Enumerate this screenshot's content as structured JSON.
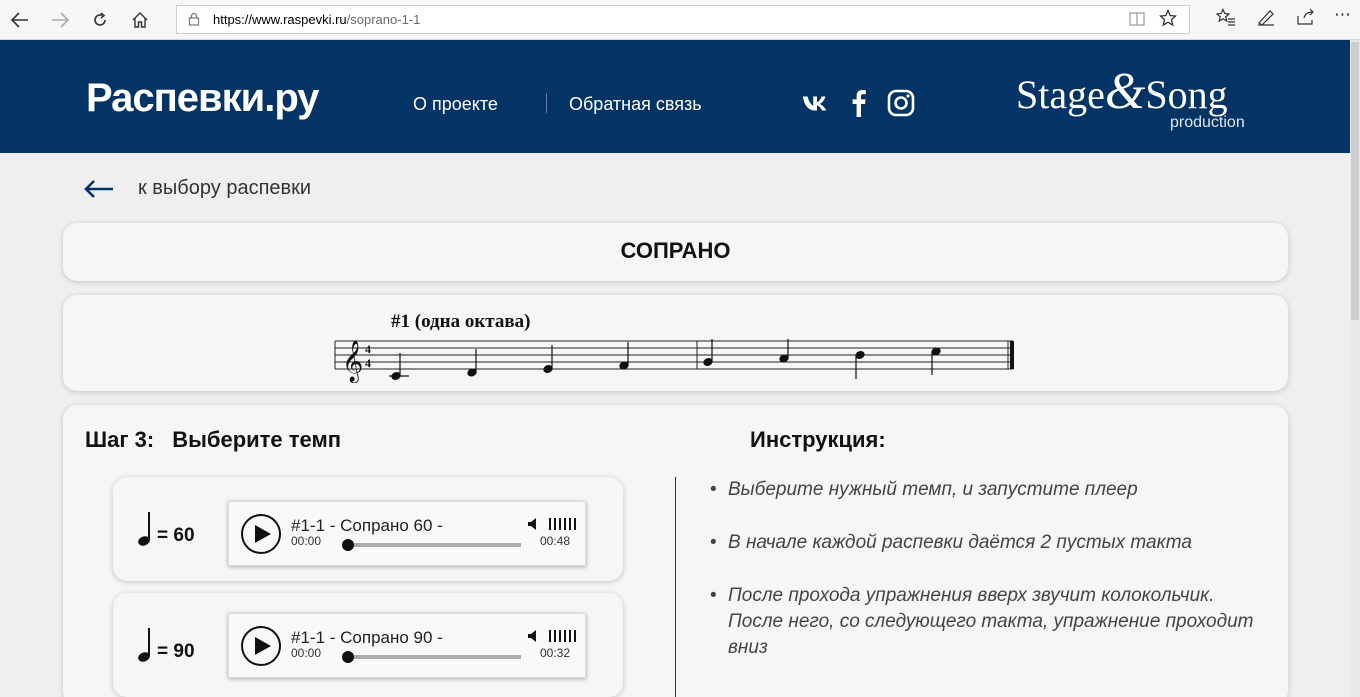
{
  "browser": {
    "url_host": "https://www.raspevki.ru",
    "url_path": "/soprano-1-1",
    "icons": [
      "back-arrow-icon",
      "forward-arrow-icon",
      "refresh-icon",
      "home-icon",
      "lock-icon",
      "reading-view-icon",
      "favorite-star-icon",
      "favorites-list-icon",
      "pen-icon",
      "share-icon",
      "more-icon"
    ]
  },
  "header": {
    "logo": "Распевки.ру",
    "menu": [
      "О проекте",
      "Обратная связь"
    ],
    "social": [
      "vk-icon",
      "facebook-icon",
      "instagram-icon"
    ],
    "brand_left": "Stage",
    "brand_amp": "&",
    "brand_right": "Song",
    "brand_sub": "production",
    "bg_color": "#043366"
  },
  "back_link": "к выбору распевки",
  "title": "СОПРАНО",
  "score_title": "#1 (одна октава)",
  "step": {
    "label": "Шаг 3:",
    "text": "Выберите темп"
  },
  "instructions": {
    "title": "Инструкция:",
    "items": [
      "Выберите нужный темп, и запустите плеер",
      "В начале каждой распевки даётся 2 пустых такта",
      "После прохода упражнения вверх звучит колокольчик. После него, со следующего такта, упражнение проходит вниз"
    ]
  },
  "tempos": [
    {
      "value": "= 60",
      "track": "#1-1 - Сопрано 60 -",
      "start": "00:00",
      "end": "00:48"
    },
    {
      "value": "= 90",
      "track": "#1-1 - Сопрано 90 -",
      "start": "00:00",
      "end": "00:32"
    }
  ]
}
